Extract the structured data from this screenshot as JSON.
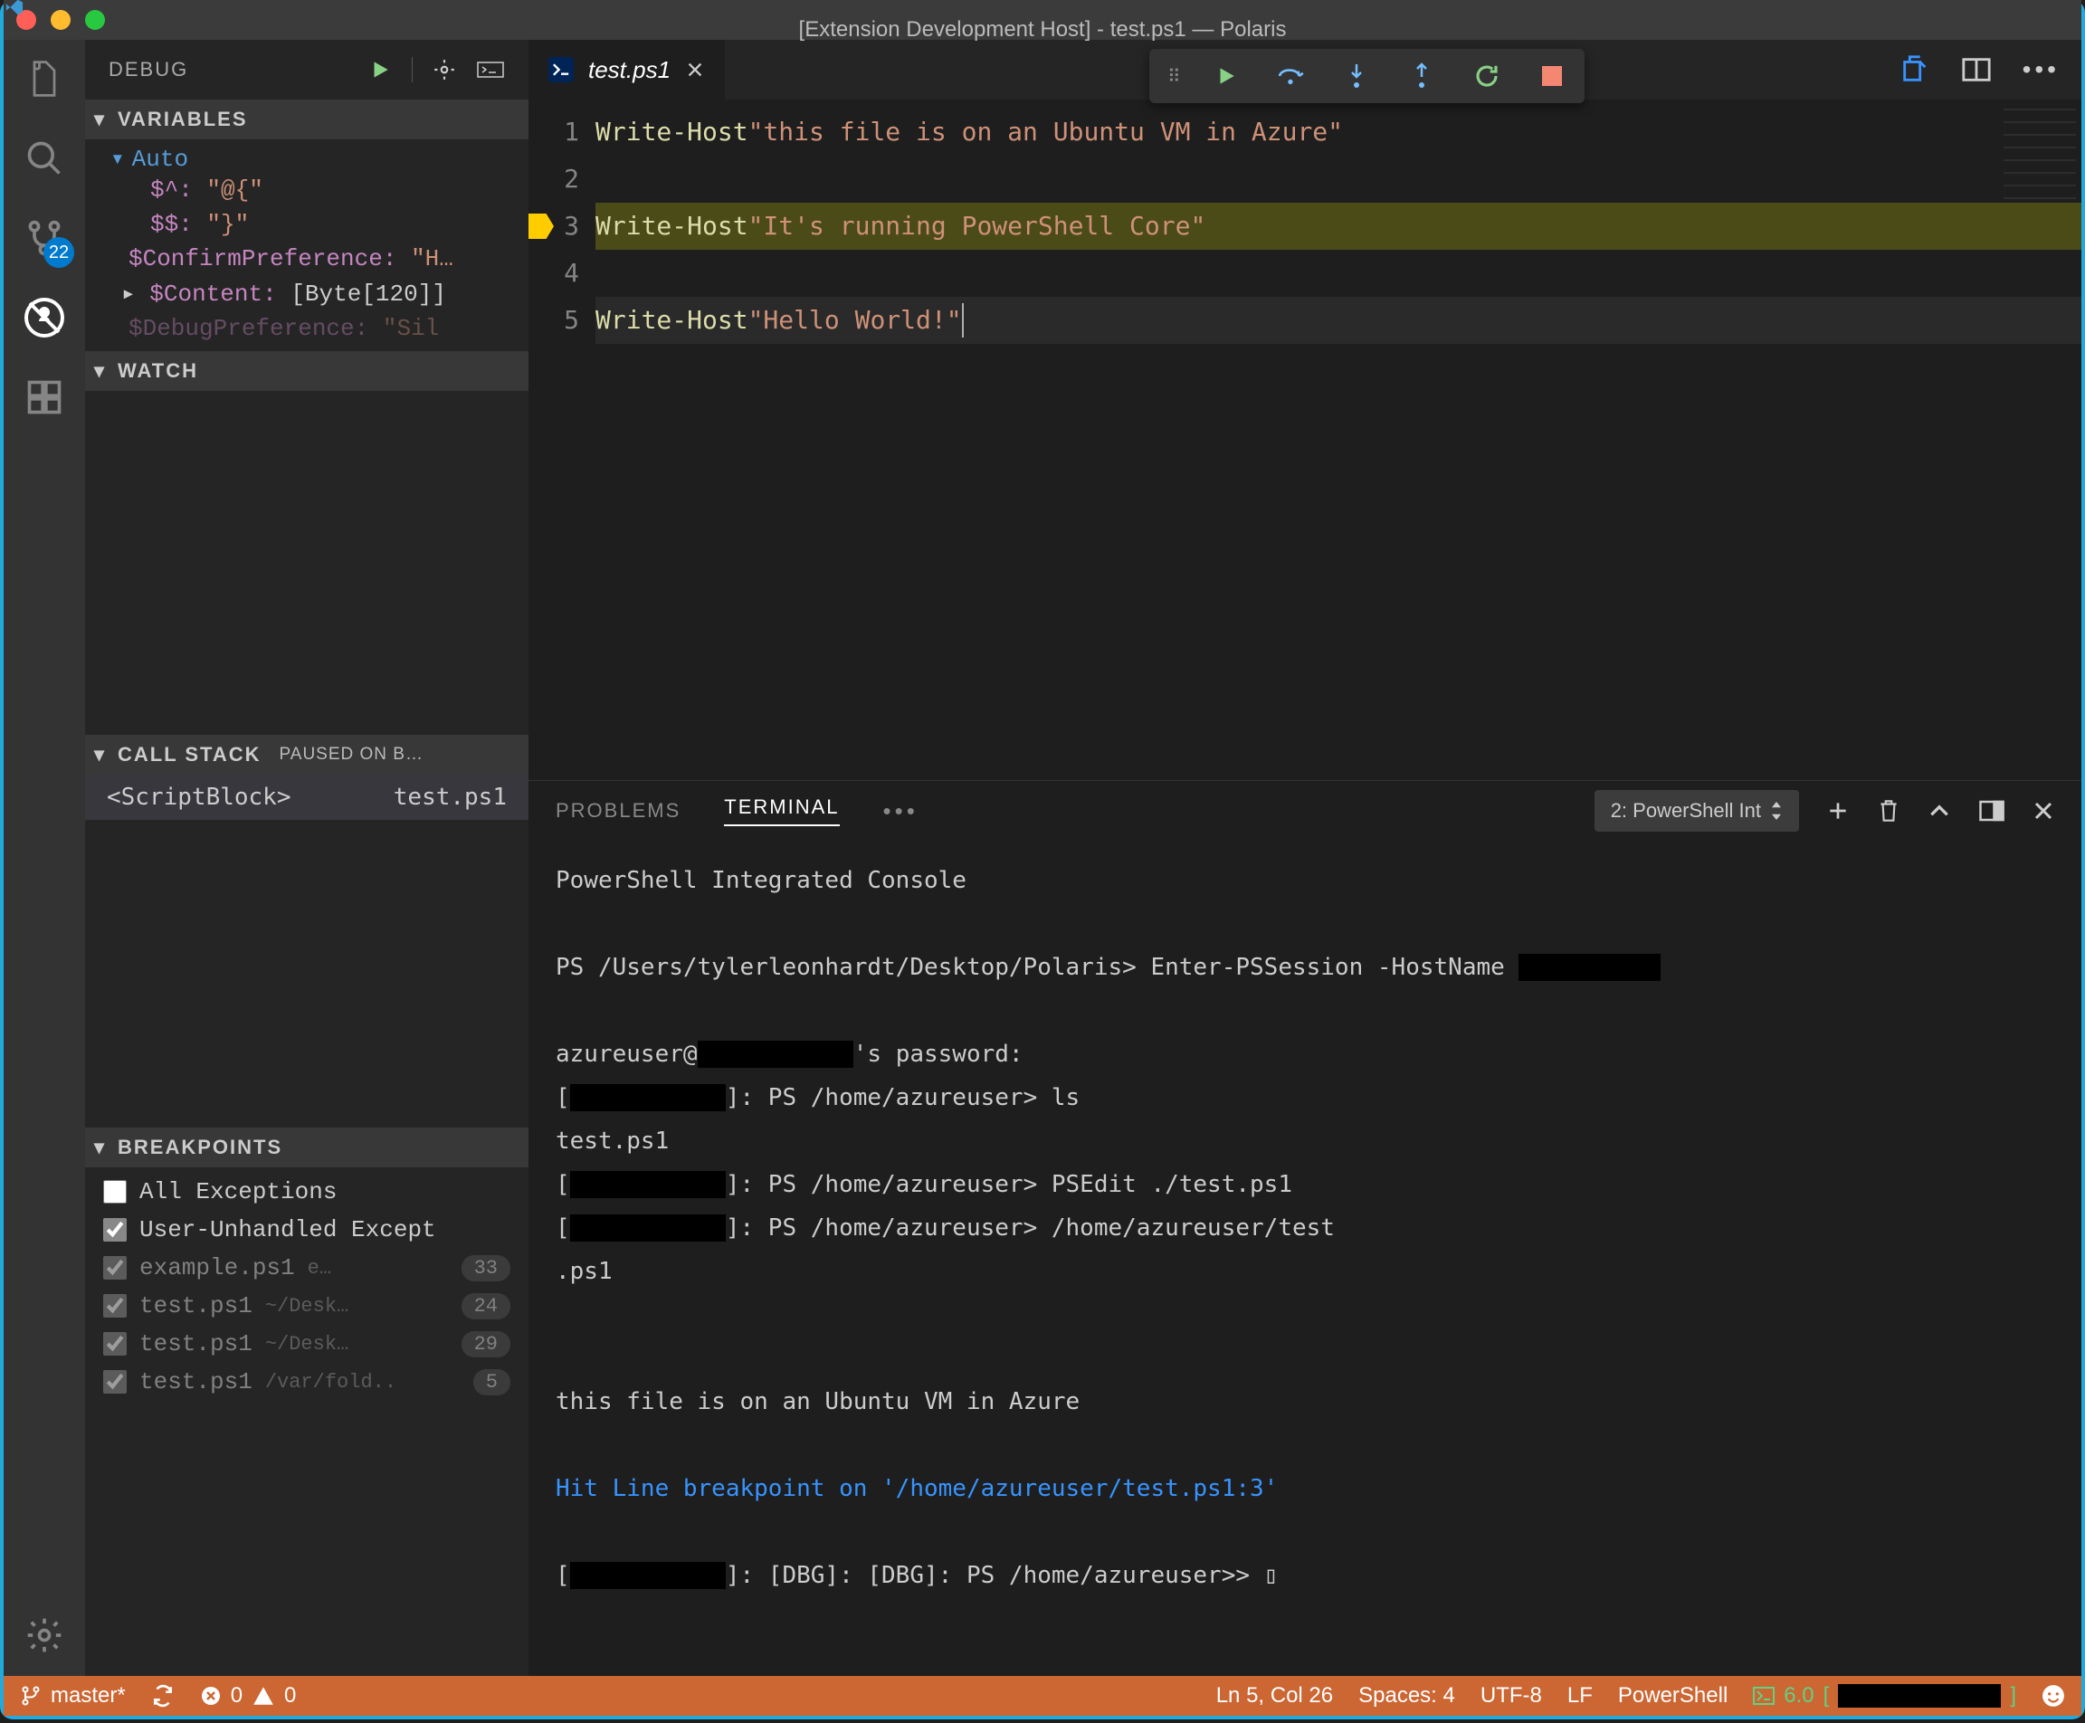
{
  "window": {
    "title": "[Extension Development Host] - test.ps1 — Polaris"
  },
  "sidebar": {
    "debug_label": "DEBUG",
    "sections": {
      "variables": {
        "title": "VARIABLES",
        "auto_label": "Auto",
        "vars": [
          {
            "name": "$^:",
            "value": "\"@{\""
          },
          {
            "name": "$$:",
            "value": "\"}\""
          },
          {
            "name": "$ConfirmPreference:",
            "value": "\"H…"
          },
          {
            "name": "$Content:",
            "value": "[Byte[120]]",
            "expandable": true
          },
          {
            "name": "$DebugPreference:",
            "value": "\"Sil"
          }
        ]
      },
      "watch": {
        "title": "WATCH"
      },
      "callstack": {
        "title": "CALL STACK",
        "status": "PAUSED ON B…",
        "frame": "<ScriptBlock>",
        "file": "test.ps1"
      },
      "breakpoints": {
        "title": "BREAKPOINTS",
        "items": [
          {
            "label": "All Exceptions",
            "checked": false,
            "dim": false
          },
          {
            "label": "User-Unhandled Except",
            "checked": true,
            "dim": false
          },
          {
            "label": "example.ps1",
            "path": "e…",
            "line": "33",
            "checked": true,
            "dim": true
          },
          {
            "label": "test.ps1",
            "path": "~/Desk…",
            "line": "24",
            "checked": true,
            "dim": true
          },
          {
            "label": "test.ps1",
            "path": "~/Desk…",
            "line": "29",
            "checked": true,
            "dim": true
          },
          {
            "label": "test.ps1",
            "path": "/var/fold..",
            "line": "5",
            "checked": true,
            "dim": true
          }
        ]
      }
    }
  },
  "activity": {
    "scm_badge": "22"
  },
  "tabs": {
    "file": "test.ps1"
  },
  "editor": {
    "lines": [
      {
        "n": "1",
        "cmd": "Write-Host",
        "str": "\"this file is on an Ubuntu VM in Azure\""
      },
      {
        "n": "2"
      },
      {
        "n": "3",
        "cmd": "Write-Host",
        "str": "\"It's running PowerShell Core\"",
        "hl": true
      },
      {
        "n": "4"
      },
      {
        "n": "5",
        "cmd": "Write-Host",
        "str": "\"Hello World!\"",
        "cursor": true
      }
    ]
  },
  "panel": {
    "tabs": {
      "problems": "PROBLEMS",
      "terminal": "TERMINAL"
    },
    "selector": "2: PowerShell Int",
    "terminal_lines": [
      {
        "t": "PowerShell Integrated Console"
      },
      {
        "t": ""
      },
      {
        "segs": [
          {
            "t": "PS /Users/tylerleonhardt/Desktop/Polaris> Enter-PSSession -HostName "
          },
          {
            "t": "XXXXXXXXXX",
            "redact": true
          }
        ]
      },
      {
        "t": ""
      },
      {
        "segs": [
          {
            "t": "azureuser@"
          },
          {
            "t": "XXXXXXXXXXX",
            "redact": true
          },
          {
            "t": "'s password:"
          }
        ]
      },
      {
        "segs": [
          {
            "t": "["
          },
          {
            "t": "XXXXXXXXXXX",
            "redact": true
          },
          {
            "t": "]: PS /home/azureuser> ls"
          }
        ]
      },
      {
        "t": "test.ps1"
      },
      {
        "segs": [
          {
            "t": "["
          },
          {
            "t": "XXXXXXXXXXX",
            "redact": true
          },
          {
            "t": "]: PS /home/azureuser> PSEdit ./test.ps1"
          }
        ]
      },
      {
        "segs": [
          {
            "t": "["
          },
          {
            "t": "XXXXXXXXXXX",
            "redact": true
          },
          {
            "t": "]: PS /home/azureuser> /home/azureuser/test"
          }
        ]
      },
      {
        "t": ".ps1"
      },
      {
        "t": ""
      },
      {
        "t": ""
      },
      {
        "t": "this file is on an Ubuntu VM in Azure"
      },
      {
        "t": ""
      },
      {
        "t": "Hit Line breakpoint on '/home/azureuser/test.ps1:3'",
        "cls": "blue"
      },
      {
        "t": ""
      },
      {
        "segs": [
          {
            "t": "["
          },
          {
            "t": "XXXXXXXXXXX",
            "redact": true
          },
          {
            "t": "]: [DBG]: [DBG]: PS /home/azureuser>> "
          },
          {
            "t": "▯"
          }
        ]
      }
    ]
  },
  "status": {
    "branch": "master*",
    "errors": "0",
    "warnings": "0",
    "position": "Ln 5, Col 26",
    "spaces": "Spaces: 4",
    "encoding": "UTF-8",
    "eol": "LF",
    "language": "PowerShell",
    "ps_version": "6.0 ",
    "ps_bracket_l": "[",
    "ps_bracket_r": "]"
  }
}
